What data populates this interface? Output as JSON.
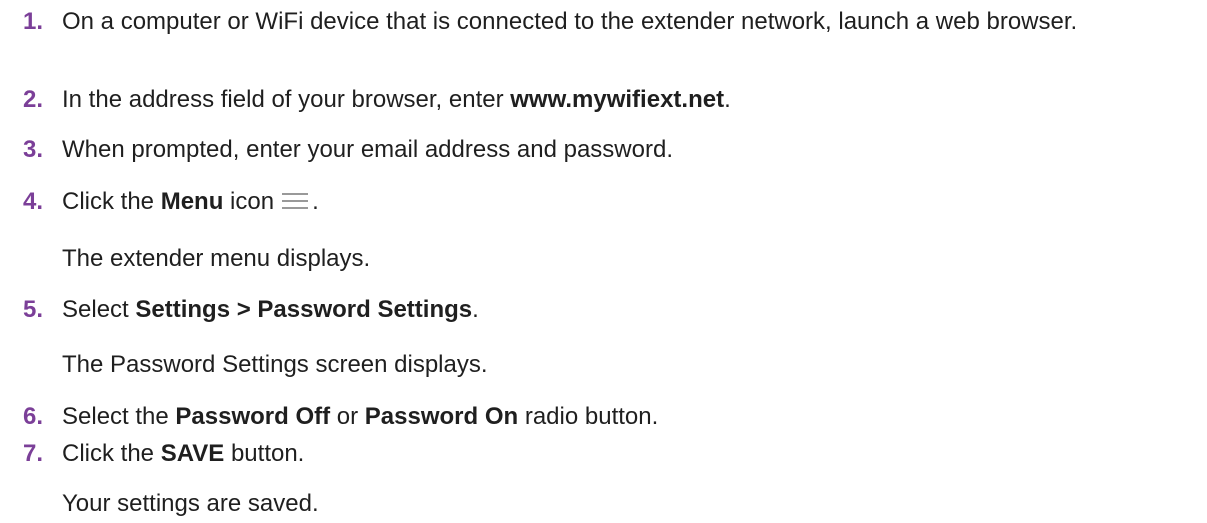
{
  "colors": {
    "step_number": "#7b3f98",
    "text": "#1f1f1f",
    "icon": "#999999"
  },
  "steps": [
    {
      "number": "1.",
      "text": "On a computer or WiFi device that is connected to the extender network, launch a web browser."
    },
    {
      "number": "2.",
      "pre": "In the address field of your browser, enter ",
      "bold": "www.mywifiext.net",
      "post": "."
    },
    {
      "number": "3.",
      "text": "When prompted, enter your email address and password."
    },
    {
      "number": "4.",
      "pre": "Click the ",
      "bold": "Menu",
      "post_icon": " icon",
      "after_icon": ".",
      "icon": "hamburger-menu-icon",
      "note": "The extender menu displays."
    },
    {
      "number": "5.",
      "pre": "Select ",
      "bold": "Settings > Password Settings",
      "post": ".",
      "note": "The Password Settings screen displays."
    },
    {
      "number": "6.",
      "pre": "Select the ",
      "bold": "Password Off",
      "mid": " or ",
      "bold2": "Password On",
      "post": " radio button."
    },
    {
      "number": "7.",
      "pre": "Click the ",
      "bold": "SAVE",
      "post": " button.",
      "note": "Your settings are saved."
    }
  ]
}
